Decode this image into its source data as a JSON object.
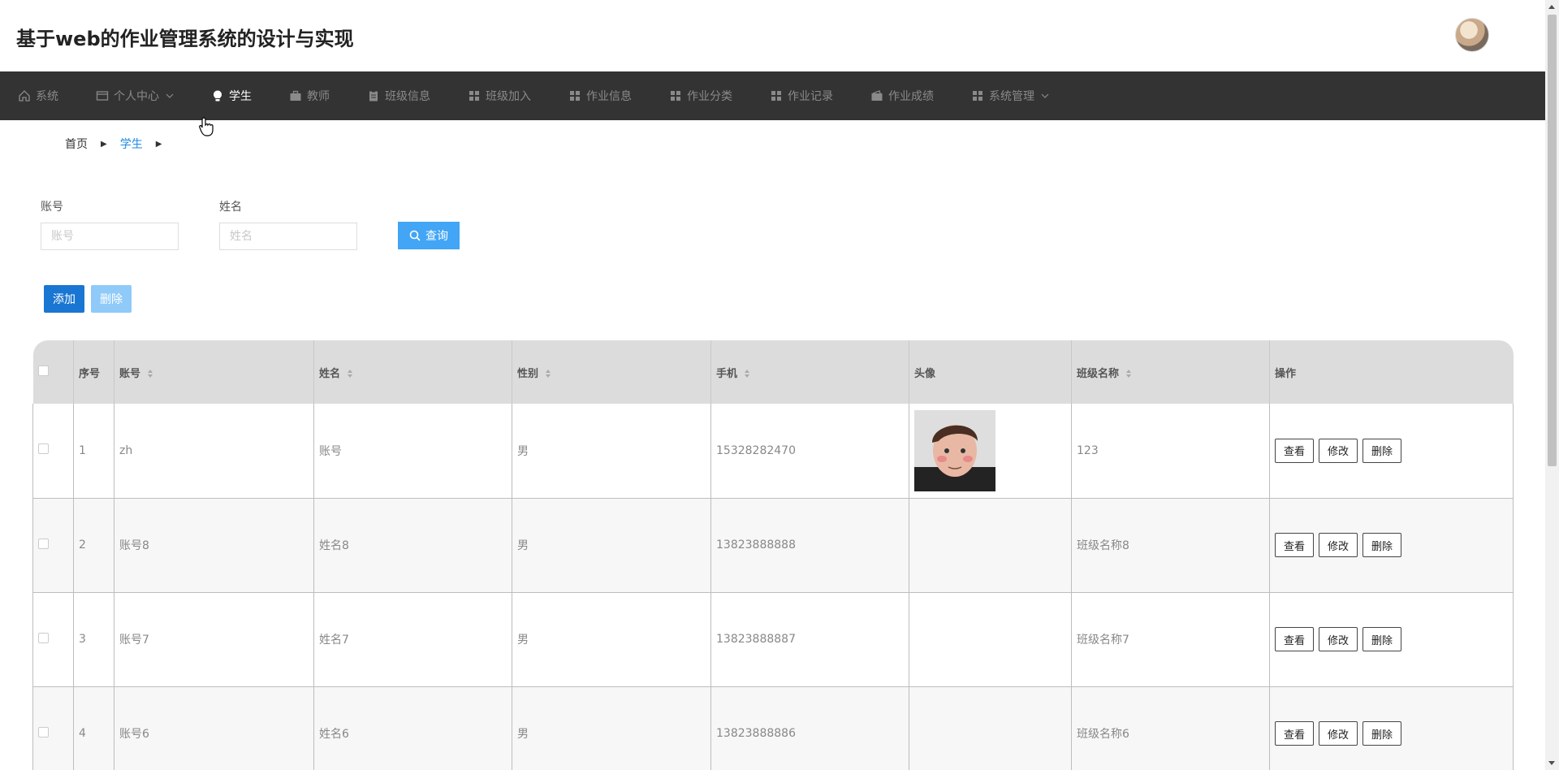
{
  "app": {
    "title": "基于web的作业管理系统的设计与实现"
  },
  "nav": {
    "items": [
      {
        "label": "系统",
        "icon": "home-icon",
        "active": false,
        "dropdown": false
      },
      {
        "label": "个人中心",
        "icon": "card-icon",
        "active": false,
        "dropdown": true
      },
      {
        "label": "学生",
        "icon": "bulb-icon",
        "active": true,
        "dropdown": false
      },
      {
        "label": "教师",
        "icon": "briefcase-icon",
        "active": false,
        "dropdown": false
      },
      {
        "label": "班级信息",
        "icon": "clipboard-icon",
        "active": false,
        "dropdown": false
      },
      {
        "label": "班级加入",
        "icon": "grid-icon",
        "active": false,
        "dropdown": false
      },
      {
        "label": "作业信息",
        "icon": "grid-icon",
        "active": false,
        "dropdown": false
      },
      {
        "label": "作业分类",
        "icon": "grid-icon",
        "active": false,
        "dropdown": false
      },
      {
        "label": "作业记录",
        "icon": "grid-icon",
        "active": false,
        "dropdown": false
      },
      {
        "label": "作业成绩",
        "icon": "wallet-icon",
        "active": false,
        "dropdown": false
      },
      {
        "label": "系统管理",
        "icon": "grid-icon",
        "active": false,
        "dropdown": true
      }
    ]
  },
  "breadcrumb": {
    "home": "首页",
    "current": "学生"
  },
  "search": {
    "account_label": "账号",
    "account_placeholder": "账号",
    "name_label": "姓名",
    "name_placeholder": "姓名",
    "query_label": "查询"
  },
  "toolbar": {
    "add_label": "添加",
    "delete_label": "删除"
  },
  "table": {
    "headers": {
      "index": "序号",
      "account": "账号",
      "name": "姓名",
      "gender": "性别",
      "phone": "手机",
      "avatar": "头像",
      "class_name": "班级名称",
      "actions": "操作"
    },
    "action_labels": {
      "view": "查看",
      "edit": "修改",
      "delete": "删除"
    },
    "rows": [
      {
        "index": "1",
        "account": "zh",
        "name": "账号",
        "gender": "男",
        "phone": "15328282470",
        "has_avatar": true,
        "class_name": "123"
      },
      {
        "index": "2",
        "account": "账号8",
        "name": "姓名8",
        "gender": "男",
        "phone": "13823888888",
        "has_avatar": false,
        "class_name": "班级名称8"
      },
      {
        "index": "3",
        "account": "账号7",
        "name": "姓名7",
        "gender": "男",
        "phone": "13823888887",
        "has_avatar": false,
        "class_name": "班级名称7"
      },
      {
        "index": "4",
        "account": "账号6",
        "name": "姓名6",
        "gender": "男",
        "phone": "13823888886",
        "has_avatar": false,
        "class_name": "班级名称6"
      }
    ]
  },
  "colors": {
    "nav_bg": "#333333",
    "primary": "#1976d2",
    "query": "#42a5f5",
    "delete_disabled": "#90caf9",
    "header_bg": "#dcdcdc"
  }
}
